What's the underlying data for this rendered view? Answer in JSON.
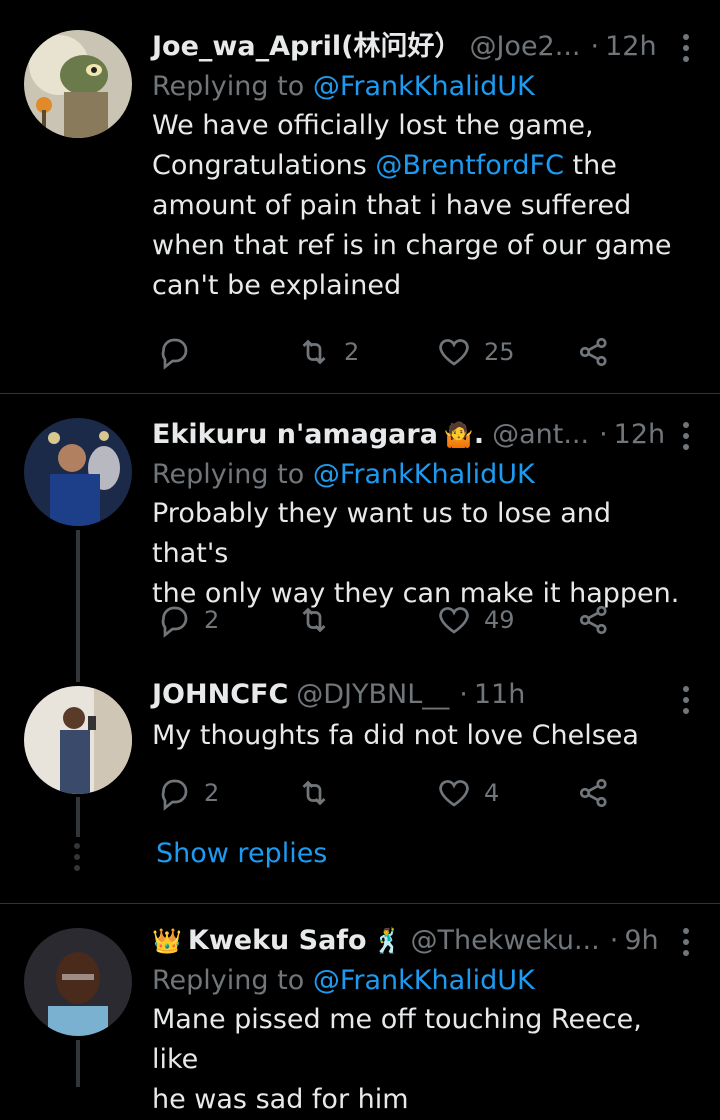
{
  "tweets": [
    {
      "name": "Joe_wa_April(林问好）",
      "handle": "@Joe2...",
      "dot": "·",
      "time": "12h",
      "replying_prefix": "Replying to",
      "replying_to": "@FrankKhalidUK",
      "text_parts": [
        "We have officially lost the game,",
        "Congratulations",
        "@BrentfordFC",
        "the",
        "amount of pain that i have suffered",
        "when that ref is in charge of our game",
        "can't be explained"
      ],
      "replies": "",
      "retweets": "2",
      "likes": "25"
    },
    {
      "name": "Ekikuru n'amagara",
      "emoji": "🤷",
      "name_suffix": ".",
      "handle": "@ant...",
      "dot": "·",
      "time": "12h",
      "replying_prefix": "Replying to",
      "replying_to": "@FrankKhalidUK",
      "text_lines": [
        "Probably they want us to lose and that's",
        "the only way they can make it happen."
      ],
      "replies": "2",
      "retweets": "",
      "likes": "49"
    },
    {
      "name": "JOHNCFC",
      "handle": "@DJYBNL__",
      "dot": "·",
      "time": "11h",
      "text_lines": [
        "My thoughts fa did not love Chelsea"
      ],
      "replies": "2",
      "retweets": "",
      "likes": "4"
    },
    {
      "crown": "👑",
      "name": "Kweku Safo",
      "emoji": "🕺",
      "handle": "@Thekweku...",
      "dot": "·",
      "time": "9h",
      "replying_prefix": "Replying to",
      "replying_to": "@FrankKhalidUK",
      "text_lines": [
        "Mane pissed me off touching Reece, like",
        "he was sad for him"
      ]
    }
  ],
  "show_replies": "Show replies",
  "icons": {
    "reply": "reply-icon",
    "retweet": "retweet-icon",
    "like": "heart-icon",
    "share": "share-icon",
    "more": "more-icon"
  },
  "colors": {
    "background": "#000000",
    "text": "#e7e9ea",
    "secondary": "#71767b",
    "link": "#1d9bf0",
    "divider": "#2f3336"
  }
}
